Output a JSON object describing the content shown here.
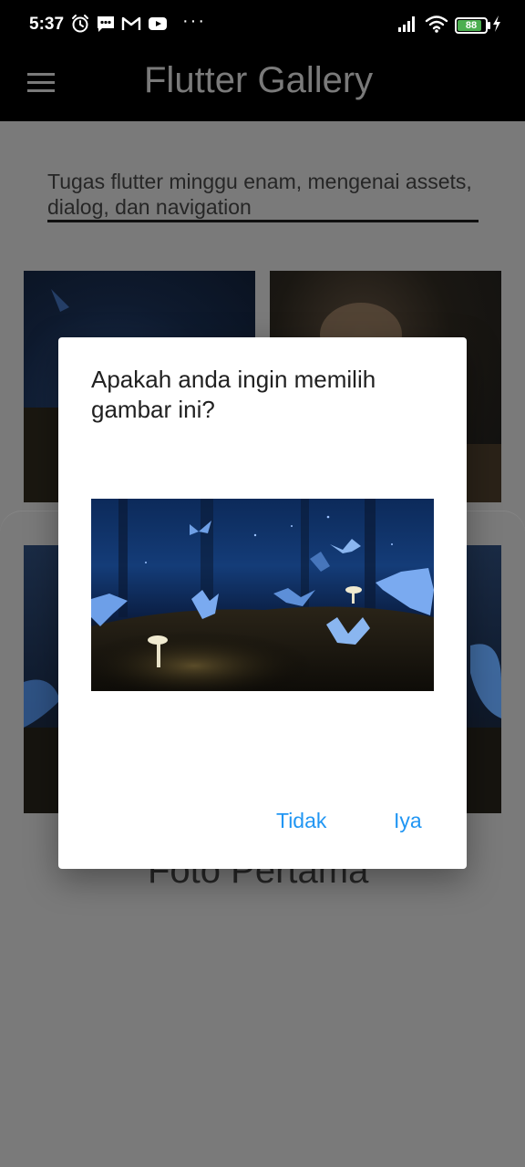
{
  "status_bar": {
    "time": "5:37",
    "battery": "88",
    "battery_level": 0.88,
    "more": "···",
    "icons": [
      "alarm-icon",
      "message-icon",
      "gmail-icon",
      "youtube-icon",
      "signal-icon",
      "wifi-icon",
      "battery-icon",
      "charging-icon"
    ]
  },
  "app_bar": {
    "title": "Flutter Gallery",
    "menu_icon": "hamburger-menu-icon"
  },
  "page": {
    "subtitle": "Tugas flutter minggu enam, mengenai assets, dialog, dan navigation",
    "sheet_title": "Foto Pertama"
  },
  "dialog": {
    "title": "Apakah anda ingin memilih gambar ini?",
    "cancel_label": "Tidak",
    "confirm_label": "Iya"
  },
  "colors": {
    "accent": "#2196f3",
    "scrim": "#7a7a7a",
    "dialog_bg": "#ffffff"
  }
}
